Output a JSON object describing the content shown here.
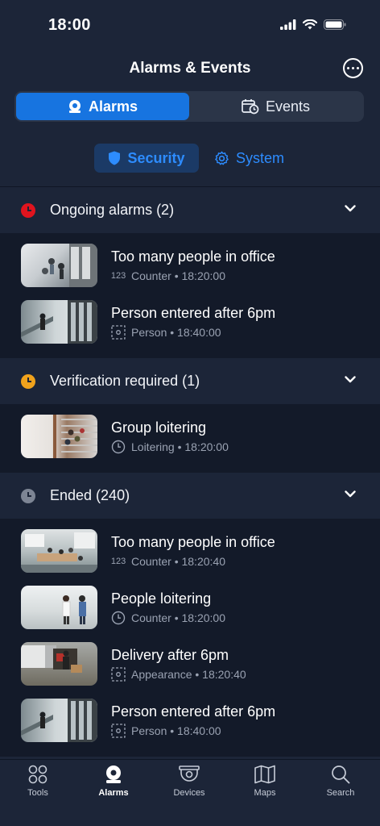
{
  "status": {
    "time": "18:00"
  },
  "header": {
    "title": "Alarms & Events",
    "more": "more"
  },
  "segment": {
    "alarms": "Alarms",
    "events": "Events"
  },
  "subtabs": {
    "security": "Security",
    "system": "System"
  },
  "groups": [
    {
      "label": "Ongoing alarms (2)",
      "color": "#e0141e",
      "items": [
        {
          "title": "Too many people in office",
          "meta": "Counter • 18:20:00",
          "icon": "counter-icon"
        },
        {
          "title": "Person entered after 6pm",
          "meta": "Person • 18:40:00",
          "icon": "person-box-icon"
        }
      ]
    },
    {
      "label": "Verification required (1)",
      "color": "#f0a21c",
      "items": [
        {
          "title": "Group loitering",
          "meta": "Loitering • 18:20:00",
          "icon": "clock-icon"
        }
      ]
    },
    {
      "label": "Ended (240)",
      "color": "#7d8594",
      "items": [
        {
          "title": "Too many people in office",
          "meta": "Counter • 18:20:40",
          "icon": "counter-icon"
        },
        {
          "title": "People loitering",
          "meta": "Counter • 18:20:00",
          "icon": "clock-icon"
        },
        {
          "title": "Delivery after 6pm",
          "meta": "Appearance • 18:20:40",
          "icon": "person-box-icon"
        },
        {
          "title": "Person entered after 6pm",
          "meta": "Person • 18:40:00",
          "icon": "person-box-icon"
        }
      ]
    }
  ],
  "tabbar": {
    "tools": "Tools",
    "alarms": "Alarms",
    "devices": "Devices",
    "maps": "Maps",
    "search": "Search"
  }
}
